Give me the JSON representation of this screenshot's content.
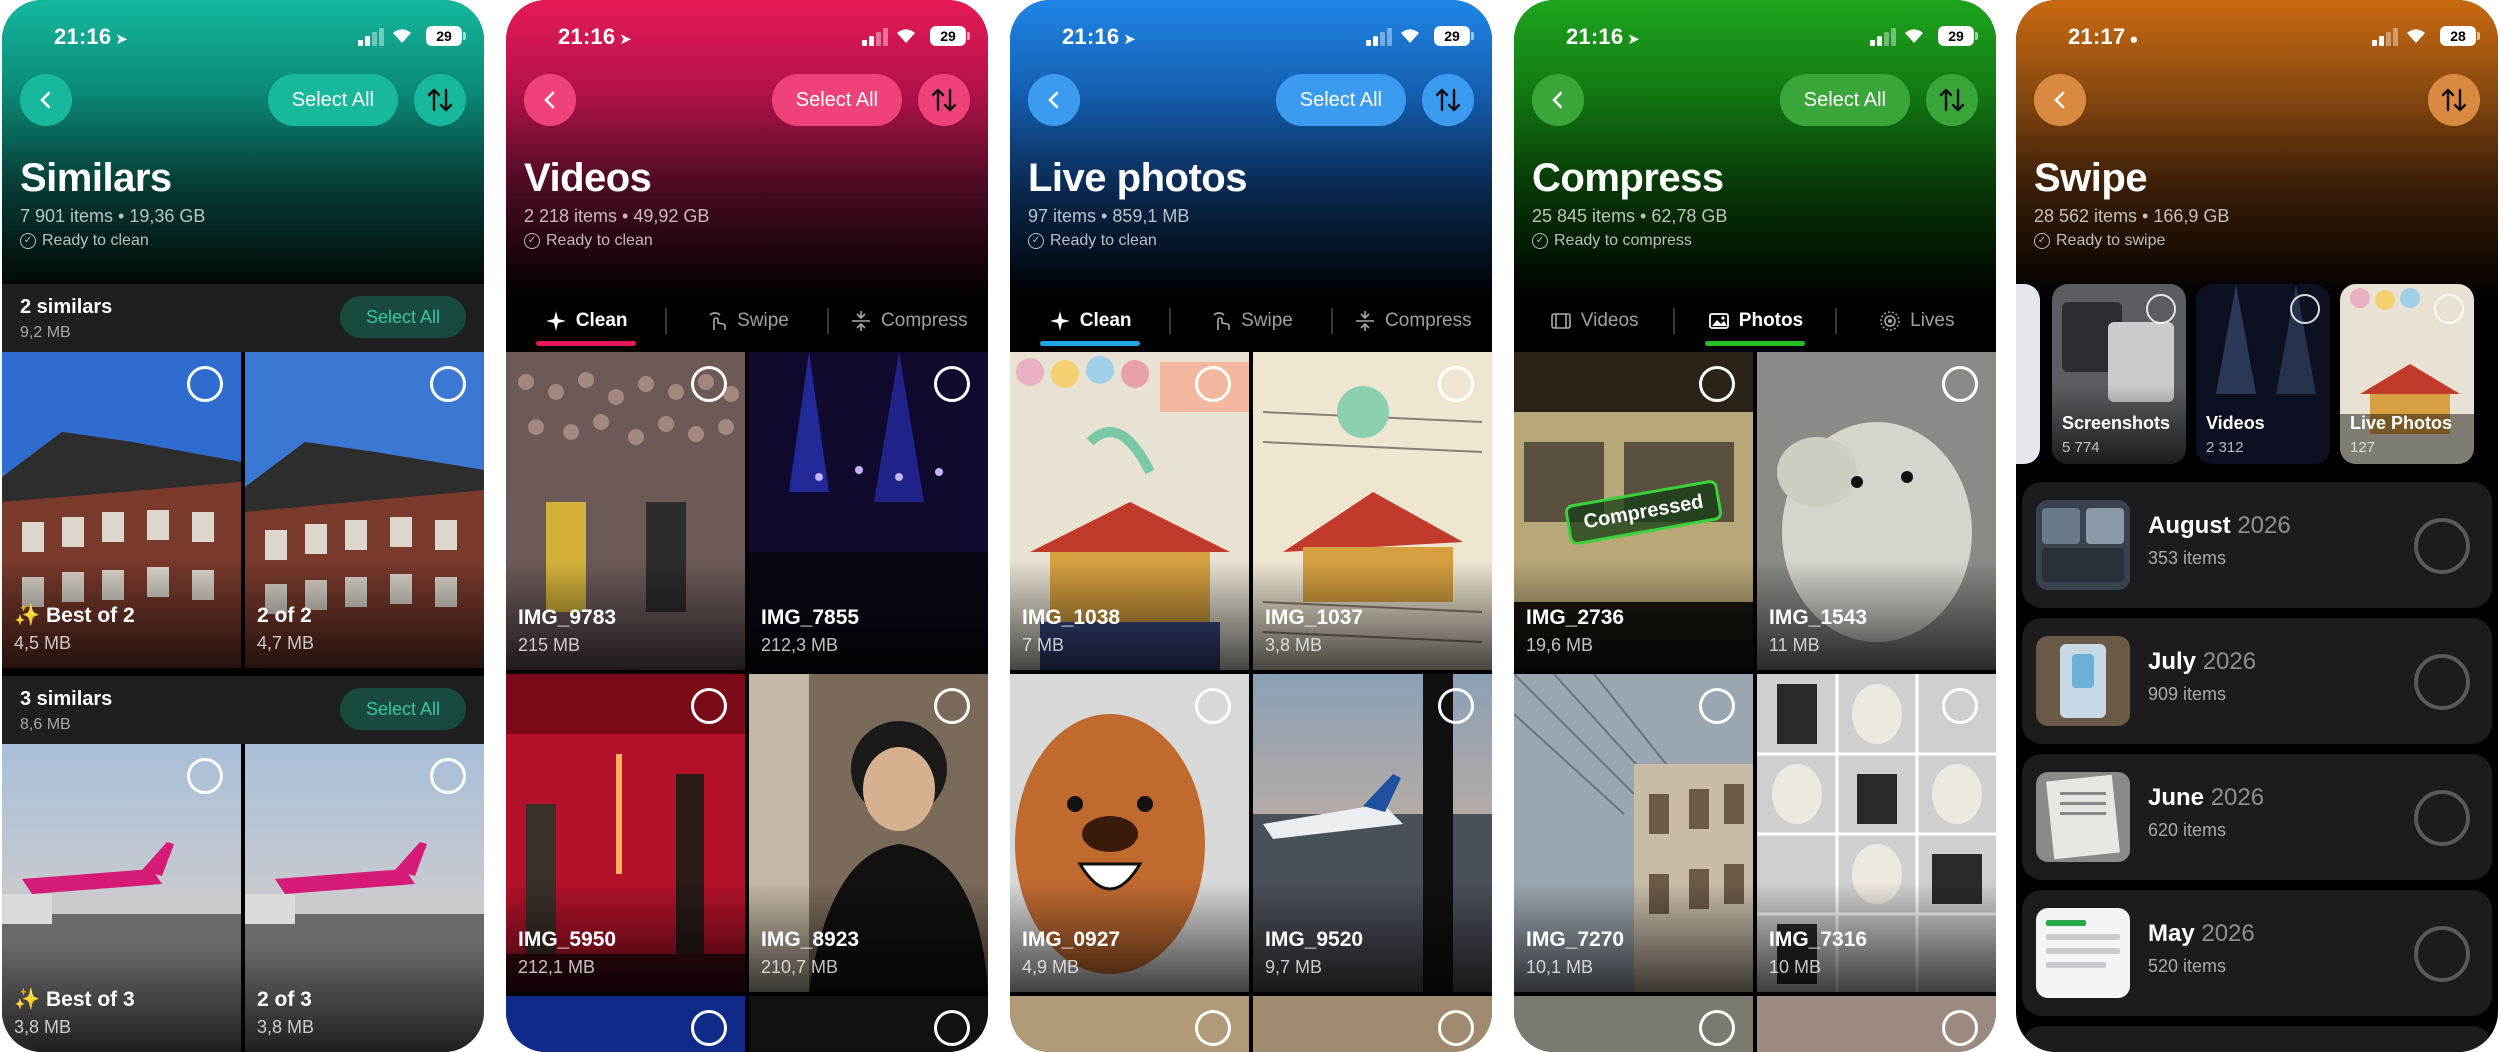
{
  "colors": {
    "similars": "#17b8a0",
    "videos": "#e5175b",
    "live": "#1f7fe0",
    "compress": "#20a020",
    "swipe": "#c46a12"
  },
  "status_bar": {
    "time_1": "21:16",
    "time_2": "21:16",
    "time_3": "21:16",
    "time_4": "21:16",
    "time_5": "21:17",
    "battery_1": "29",
    "battery_5": "28"
  },
  "common": {
    "select_all": "Select All"
  },
  "similars": {
    "title": "Similars",
    "meta": "7 901 items • 19,36 GB",
    "status": "Ready to clean",
    "groups": [
      {
        "title": "2 similars",
        "size": "9,2 MB",
        "button": "Select All",
        "items": [
          {
            "name": "✨ Best of 2",
            "size": "4,5 MB"
          },
          {
            "name": "2 of 2",
            "size": "4,7 MB"
          }
        ]
      },
      {
        "title": "3 similars",
        "size": "8,6 MB",
        "button": "Select All",
        "items": [
          {
            "name": "✨ Best of 3",
            "size": "3,8 MB"
          },
          {
            "name": "2 of 3",
            "size": "3,8 MB"
          }
        ]
      }
    ]
  },
  "videos": {
    "title": "Videos",
    "meta": "2 218 items • 49,92 GB",
    "status": "Ready to clean",
    "tabs": [
      "Clean",
      "Swipe",
      "Compress"
    ],
    "items": [
      {
        "name": "IMG_9783",
        "size": "215 MB"
      },
      {
        "name": "IMG_7855",
        "size": "212,3 MB"
      },
      {
        "name": "IMG_5950",
        "size": "212,1 MB"
      },
      {
        "name": "IMG_8923",
        "size": "210,7 MB"
      }
    ]
  },
  "live": {
    "title": "Live photos",
    "meta": "97 items • 859,1 MB",
    "status": "Ready to clean",
    "tabs": [
      "Clean",
      "Swipe",
      "Compress"
    ],
    "items": [
      {
        "name": "IMG_1038",
        "size": "7 MB"
      },
      {
        "name": "IMG_1037",
        "size": "3,8 MB"
      },
      {
        "name": "IMG_0927",
        "size": "4,9 MB"
      },
      {
        "name": "IMG_9520",
        "size": "9,7 MB"
      }
    ]
  },
  "compress": {
    "title": "Compress",
    "meta": "25 845 items • 62,78 GB",
    "status": "Ready to compress",
    "tabs": [
      "Videos",
      "Photos",
      "Lives"
    ],
    "stamp": "Compressed",
    "items": [
      {
        "name": "IMG_2736",
        "size": "19,6 MB"
      },
      {
        "name": "IMG_1543",
        "size": "11 MB"
      },
      {
        "name": "IMG_7270",
        "size": "10,1 MB"
      },
      {
        "name": "IMG_7316",
        "size": "10 MB"
      }
    ]
  },
  "swipe": {
    "title": "Swipe",
    "meta": "28 562 items • 166,9 GB",
    "status": "Ready to swipe",
    "albums": [
      {
        "title": "Screenshots",
        "count": "5 774"
      },
      {
        "title": "Videos",
        "count": "2 312"
      },
      {
        "title": "Live Photos",
        "count": "127"
      }
    ],
    "months": [
      {
        "month": "August",
        "year": "2026",
        "count": "353 items"
      },
      {
        "month": "July",
        "year": "2026",
        "count": "909 items"
      },
      {
        "month": "June",
        "year": "2026",
        "count": "620 items"
      },
      {
        "month": "May",
        "year": "2026",
        "count": "520 items"
      }
    ]
  }
}
